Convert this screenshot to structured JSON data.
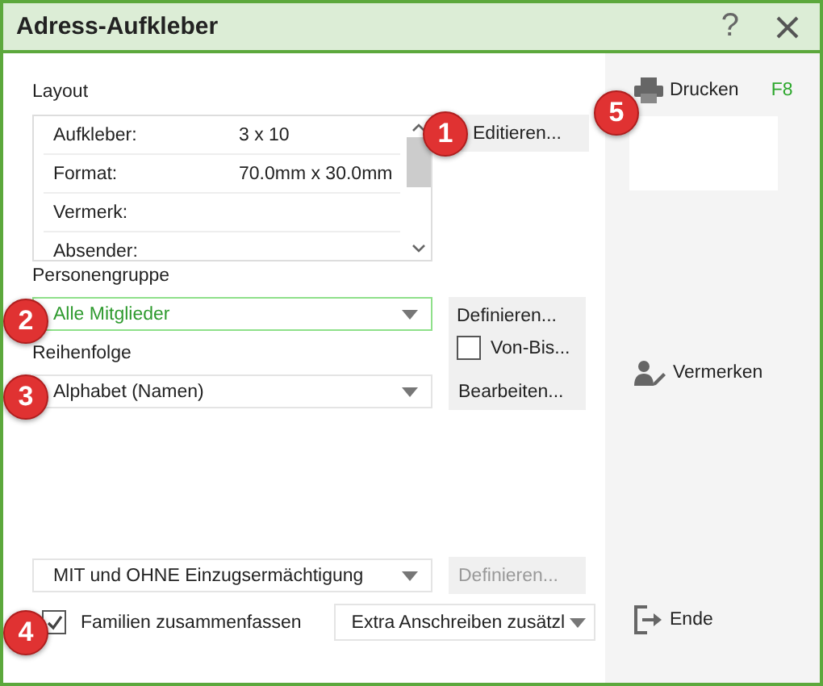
{
  "window": {
    "title": "Adress-Aufkleber",
    "help": "?"
  },
  "layout": {
    "label": "Layout",
    "button": "Editieren...",
    "rows": [
      {
        "name": "Aufkleber:",
        "value": "3 x 10"
      },
      {
        "name": "Format:",
        "value": "70.0mm x 30.0mm"
      },
      {
        "name": "Vermerk:"
      },
      {
        "name": "Absender:"
      }
    ]
  },
  "group": {
    "label": "Personengruppe",
    "value": "Alle Mitglieder",
    "focused": true,
    "button": "Definieren...",
    "range": {
      "label": "Von-Bis...",
      "checked": false
    }
  },
  "order": {
    "label": "Reihenfolge",
    "value": "Alphabet (Namen)",
    "button": "Bearbeiten..."
  },
  "mandate": {
    "value": "MIT und OHNE Einzugsermächtigung",
    "button": {
      "label": "Definieren...",
      "disabled": true
    }
  },
  "family": {
    "label": "Familien zusammenfassen",
    "checked": true
  },
  "extra": {
    "value": "Extra Anschreiben zusätzl"
  },
  "side": [
    {
      "kind": "print",
      "label": "Drucken",
      "shortcut": "F8"
    },
    {
      "kind": "note",
      "label": "Vermerken"
    },
    {
      "kind": "exit",
      "label": "Ende"
    }
  ],
  "badges": [
    "1",
    "2",
    "3",
    "4",
    "5"
  ]
}
